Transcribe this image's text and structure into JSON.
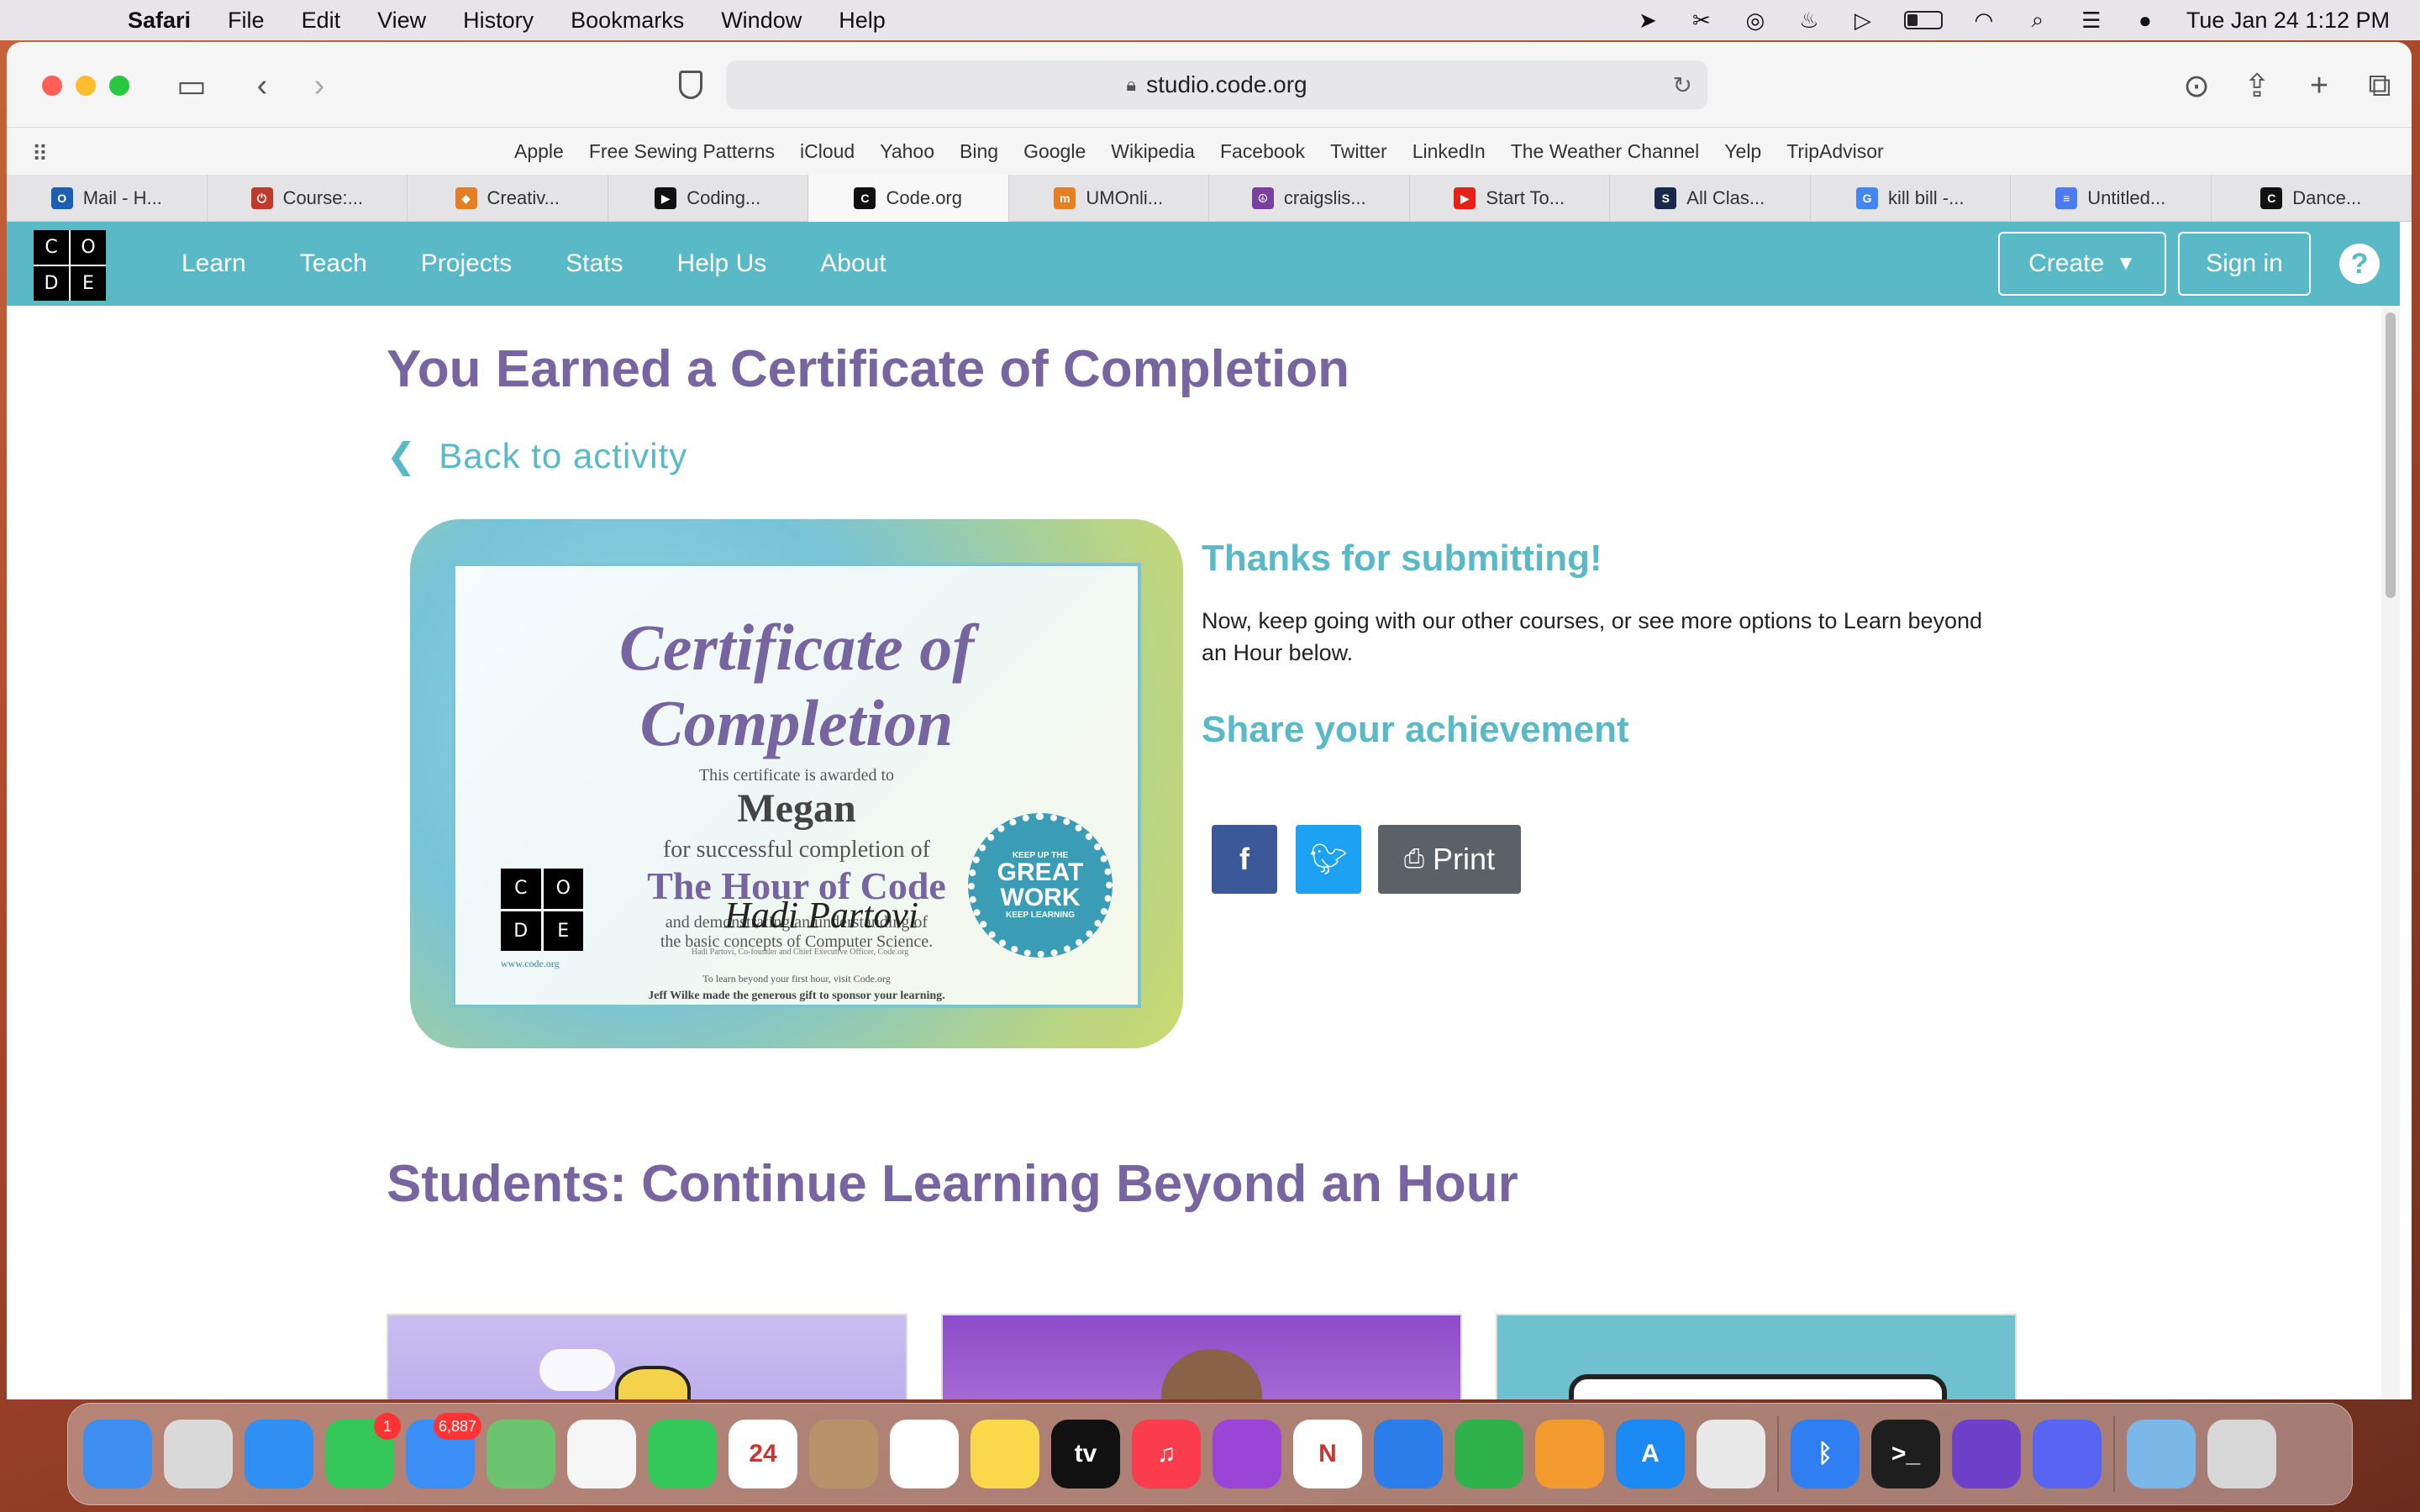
{
  "menubar": {
    "app": "Safari",
    "items": [
      "File",
      "Edit",
      "View",
      "History",
      "Bookmarks",
      "Window",
      "Help"
    ],
    "clock": "Tue Jan 24  1:12 PM"
  },
  "browser": {
    "url": "studio.code.org",
    "favorites": [
      "Apple",
      "Free Sewing Patterns",
      "iCloud",
      "Yahoo",
      "Bing",
      "Google",
      "Wikipedia",
      "Facebook",
      "Twitter",
      "LinkedIn",
      "The Weather Channel",
      "Yelp",
      "TripAdvisor"
    ],
    "tabs": [
      {
        "label": "Mail - H...",
        "color": "#1a5fb4",
        "glyph": "O"
      },
      {
        "label": "Course:...",
        "color": "#c0392b",
        "glyph": "⏻"
      },
      {
        "label": "Creativ...",
        "color": "#e67e22",
        "glyph": "◆"
      },
      {
        "label": "Coding...",
        "color": "#111111",
        "glyph": "▶"
      },
      {
        "label": "Code.org",
        "color": "#111111",
        "glyph": "C"
      },
      {
        "label": "UMOnli...",
        "color": "#e67e22",
        "glyph": "m"
      },
      {
        "label": "craigslis...",
        "color": "#7b3fa0",
        "glyph": "☮"
      },
      {
        "label": "Start To...",
        "color": "#e62117",
        "glyph": "▶"
      },
      {
        "label": "All Clas...",
        "color": "#1b2a4a",
        "glyph": "S"
      },
      {
        "label": "kill bill -...",
        "color": "#4285f4",
        "glyph": "G"
      },
      {
        "label": "Untitled...",
        "color": "#4a7cf0",
        "glyph": "≡"
      },
      {
        "label": "Dance...",
        "color": "#111111",
        "glyph": "C"
      }
    ],
    "active_tab": 4
  },
  "site": {
    "logo": [
      "C",
      "O",
      "D",
      "E"
    ],
    "nav": [
      "Learn",
      "Teach",
      "Projects",
      "Stats",
      "Help Us",
      "About"
    ],
    "create_label": "Create",
    "signin_label": "Sign in",
    "help_label": "?",
    "page_title": "You Earned a Certificate of Completion",
    "back_label": "Back to activity",
    "certificate": {
      "title": "Certificate of Completion",
      "awarded": "This certificate is awarded to",
      "name": "Megan",
      "for": "for successful completion of",
      "course": "The Hour of Code",
      "demo": "and demonstrating an understanding of",
      "demo2": "the basic concepts of Computer Science.",
      "signature": "Hadi Partovi",
      "signer": "Hadi Partovi, Co-founder and Chief Executive Officer, Code.org",
      "url": "www.code.org",
      "foot1": "To learn beyond your first hour, visit Code.org",
      "foot2": "Jeff Wilke made the generous gift to sponsor your learning.",
      "badge_top": "KEEP UP THE",
      "badge_main": "GREAT WORK",
      "badge_bottom": "KEEP LEARNING"
    },
    "thanks_title": "Thanks for submitting!",
    "thanks_body": "Now, keep going with our other courses, or see more options to Learn beyond an Hour below.",
    "share_title": "Share your achievement",
    "print_label": "Print",
    "section_title": "Students: Continue Learning Beyond an Hour"
  },
  "dock": {
    "icons": [
      {
        "name": "finder-icon",
        "color": "#3d8ef0",
        "label": ""
      },
      {
        "name": "launchpad-icon",
        "color": "#d9d9d9",
        "label": ""
      },
      {
        "name": "safari-icon",
        "color": "#2f8ff2",
        "label": ""
      },
      {
        "name": "messages-icon",
        "color": "#34c759",
        "label": "",
        "badge": "1"
      },
      {
        "name": "mail-icon",
        "color": "#3a8ef6",
        "label": "",
        "badge": "6,887"
      },
      {
        "name": "maps-icon",
        "color": "#6cc36e",
        "label": ""
      },
      {
        "name": "photos-icon",
        "color": "#f5f5f5",
        "label": ""
      },
      {
        "name": "facetime-icon",
        "color": "#34c759",
        "label": ""
      },
      {
        "name": "calendar-icon",
        "color": "#ffffff",
        "label": "24"
      },
      {
        "name": "contacts-icon",
        "color": "#b8936a",
        "label": ""
      },
      {
        "name": "reminders-icon",
        "color": "#ffffff",
        "label": ""
      },
      {
        "name": "notes-icon",
        "color": "#fbd84a",
        "label": ""
      },
      {
        "name": "appletv-icon",
        "color": "#111111",
        "label": "tv"
      },
      {
        "name": "music-icon",
        "color": "#fa3c4c",
        "label": "♫"
      },
      {
        "name": "podcasts-icon",
        "color": "#9b45d6",
        "label": ""
      },
      {
        "name": "news-icon",
        "color": "#ffffff",
        "label": "N"
      },
      {
        "name": "keynote-icon",
        "color": "#2b7de9",
        "label": ""
      },
      {
        "name": "numbers-icon",
        "color": "#2fb24c",
        "label": ""
      },
      {
        "name": "pages-icon",
        "color": "#f29a2e",
        "label": ""
      },
      {
        "name": "appstore-icon",
        "color": "#1c8af4",
        "label": "A"
      },
      {
        "name": "chrome-icon",
        "color": "#e8e8e8",
        "label": ""
      },
      {
        "name": "bluetooth-icon",
        "color": "#2f7ff2",
        "label": "ᛒ"
      },
      {
        "name": "terminal-icon",
        "color": "#1e1e1e",
        "label": ">_"
      },
      {
        "name": "github-icon",
        "color": "#6e40c9",
        "label": ""
      },
      {
        "name": "discord-icon",
        "color": "#5865f2",
        "label": ""
      },
      {
        "name": "downloads-icon",
        "color": "#7bb7e8",
        "label": ""
      },
      {
        "name": "trash-icon",
        "color": "#d7d7d7",
        "label": ""
      }
    ]
  }
}
